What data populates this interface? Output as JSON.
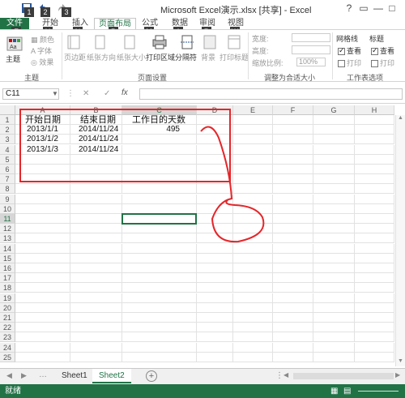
{
  "window": {
    "title": "Microsoft Excel演示.xlsx [共享] - Excel",
    "help_label": "?",
    "min_label": "—",
    "restore_label": "□",
    "close_label": "✕"
  },
  "tabs": [
    {
      "label": "文件"
    },
    {
      "label": "开始"
    },
    {
      "label": "插入"
    },
    {
      "label": "页面布局"
    },
    {
      "label": "公式"
    },
    {
      "label": "数据"
    },
    {
      "label": "审阅"
    },
    {
      "label": "视图"
    }
  ],
  "keytips": {
    "qa_save": "1",
    "qa_undo": "2",
    "qa_redo": "3",
    "file": "F",
    "home": "H",
    "insert": "N",
    "layout": "P",
    "formulas": "M",
    "data": "A",
    "review": "R",
    "view": "W"
  },
  "ribbon": {
    "theme": {
      "big_label": "主题",
      "colors": "颜色",
      "fonts": "字体",
      "effects": "效果",
      "group_label": "主题"
    },
    "page_setup": {
      "margins": "页边距",
      "orientation": "纸张方向",
      "size": "纸张大小",
      "print_area": "打印区域",
      "breaks": "分隔符",
      "background": "背景",
      "print_titles": "打印标题",
      "group_label": "页面设置"
    },
    "scale": {
      "width": "宽度:",
      "height": "高度:",
      "zoom": "缩放比例:",
      "zoom_value": "100%",
      "group_label": "调整为合适大小"
    },
    "sheet_options": {
      "gridlines": "网格线",
      "headings": "标题",
      "view": "查看",
      "print": "打印",
      "group_label": "工作表选项"
    }
  },
  "formula_bar": {
    "name_box": "C11",
    "cancel_icon": "✕",
    "enter_icon": "✓",
    "fx_label": "fx",
    "value": ""
  },
  "columns": [
    "A",
    "B",
    "C",
    "D",
    "E",
    "F",
    "G",
    "H"
  ],
  "rows": [
    "1",
    "2",
    "3",
    "4",
    "5",
    "6",
    "7",
    "8",
    "9",
    "10",
    "11",
    "12",
    "13",
    "14",
    "15",
    "16",
    "17",
    "18",
    "19",
    "20",
    "21",
    "22",
    "23",
    "24",
    "25"
  ],
  "cells": {
    "A1": "开始日期",
    "B1": "结束日期",
    "C1": "工作日的天数",
    "A2": "2013/1/1",
    "B2": "2014/11/24",
    "C2": "495",
    "A3": "2013/1/2",
    "B3": "2014/11/24",
    "A4": "2013/1/3",
    "B4": "2014/11/24"
  },
  "sheets": [
    {
      "label": "Sheet1"
    },
    {
      "label": "Sheet2"
    }
  ],
  "status": {
    "ready": "就绪"
  },
  "colors": {
    "accent": "#217346",
    "annotation": "#e5262a"
  }
}
